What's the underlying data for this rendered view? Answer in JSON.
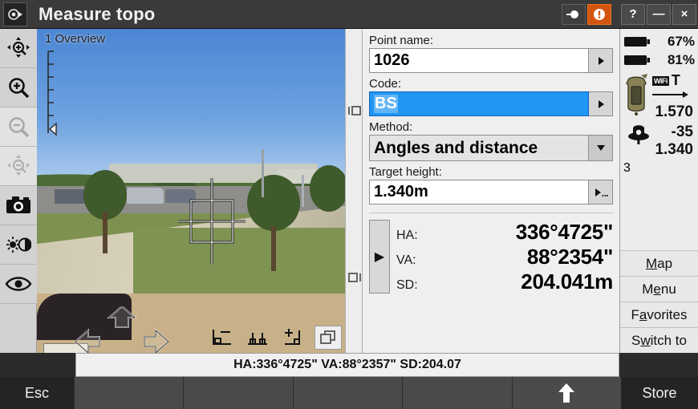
{
  "window": {
    "title": "Measure topo",
    "app_icon": "instrument-icon",
    "controls": {
      "connect_label": "➔",
      "alert_label": "!",
      "help_label": "?",
      "minimize_label": "—",
      "close_label": "×"
    }
  },
  "toolbar": {
    "items": [
      {
        "name": "zoom-to-extents-icon",
        "enabled": true
      },
      {
        "name": "zoom-in-icon",
        "enabled": true
      },
      {
        "name": "zoom-out-icon",
        "enabled": false
      },
      {
        "name": "pan-zoom-out-icon",
        "enabled": false
      },
      {
        "name": "camera-icon",
        "enabled": true
      },
      {
        "name": "brightness-contrast-icon",
        "enabled": true
      },
      {
        "name": "eye-visibility-icon",
        "enabled": true
      }
    ]
  },
  "viewport": {
    "label": "1 Overview",
    "tools": [
      {
        "name": "snap-corner-icon"
      },
      {
        "name": "snap-surface-icon"
      },
      {
        "name": "add-point-icon"
      },
      {
        "name": "panel-toggle-icon"
      }
    ]
  },
  "divider": {
    "top_icon": "dock-left-icon",
    "bottom_icon": "dock-right-icon"
  },
  "form": {
    "point_name": {
      "label": "Point name:",
      "value": "1026"
    },
    "code": {
      "label": "Code:",
      "value": "BS",
      "selected": true
    },
    "method": {
      "label": "Method:",
      "value": "Angles and distance"
    },
    "target_height": {
      "label": "Target height:",
      "value": "1.340m"
    },
    "readout": {
      "expand_label": "▶",
      "rows": [
        {
          "key": "HA:",
          "value": "336°4725\""
        },
        {
          "key": "VA:",
          "value": "88°2354\""
        },
        {
          "key": "SD:",
          "value": "204.041m"
        }
      ]
    }
  },
  "status": {
    "battery1": {
      "icon": "battery-icon",
      "value": "67%"
    },
    "battery2": {
      "icon": "battery-icon",
      "value": "81%"
    },
    "instrument": {
      "icon": "total-station-icon",
      "wifi_label": "WiFi",
      "mode_label": "T",
      "height": "1.570"
    },
    "target": {
      "icon": "prism-target-icon",
      "count": "3",
      "lock_icon": "padlock-icon",
      "signal": "-35",
      "height": "1.340"
    }
  },
  "nav": {
    "buttons": [
      {
        "label": "Map",
        "accel": "M"
      },
      {
        "label": "Menu",
        "accel": "e"
      },
      {
        "label": "Favorites",
        "accel": "a"
      },
      {
        "label": "Switch to",
        "accel": "w"
      }
    ]
  },
  "statusline": {
    "text": "HA:336°4725\"  VA:88°2357\"  SD:204.07"
  },
  "bottombar": {
    "esc_label": "Esc",
    "store_label": "Store",
    "softkeys": [
      "",
      "",
      "",
      "",
      "↑"
    ]
  },
  "colors": {
    "titlebar": "#3a3a3a",
    "alert_orange": "#d4550f",
    "selection_blue": "#2196f3",
    "panel_grey": "#efefef",
    "bottom_dark": "#2b2b2b",
    "lock_yellow": "#e8b33a"
  }
}
